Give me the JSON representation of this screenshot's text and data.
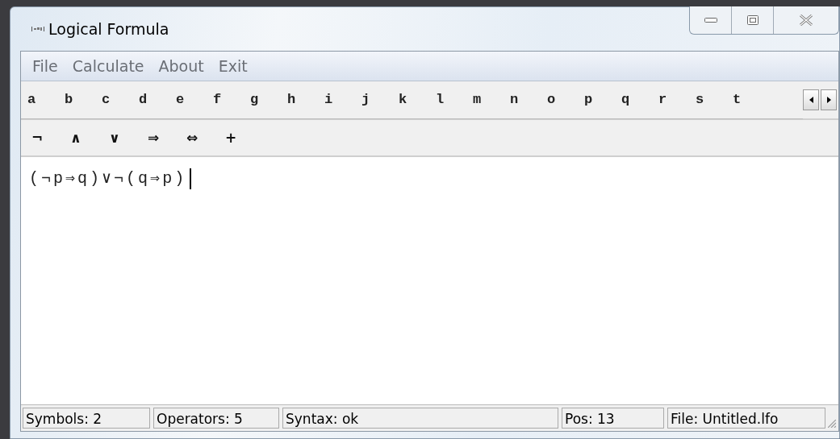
{
  "window": {
    "title": "Logical Formula"
  },
  "menu": [
    "File",
    "Calculate",
    "About",
    "Exit"
  ],
  "letters": [
    "a",
    "b",
    "c",
    "d",
    "e",
    "f",
    "g",
    "h",
    "i",
    "j",
    "k",
    "l",
    "m",
    "n",
    "o",
    "p",
    "q",
    "r",
    "s",
    "t"
  ],
  "operators": [
    "¬",
    "∧",
    "∨",
    "⇒",
    "⇔",
    "+"
  ],
  "editor": {
    "value": "(¬p⇒q)∨¬(q⇒p)"
  },
  "status_bar": [
    "Symbols: 2",
    "Operators: 5",
    "Syntax: ok",
    "Pos: 13",
    "File: Untitled.lfo"
  ]
}
